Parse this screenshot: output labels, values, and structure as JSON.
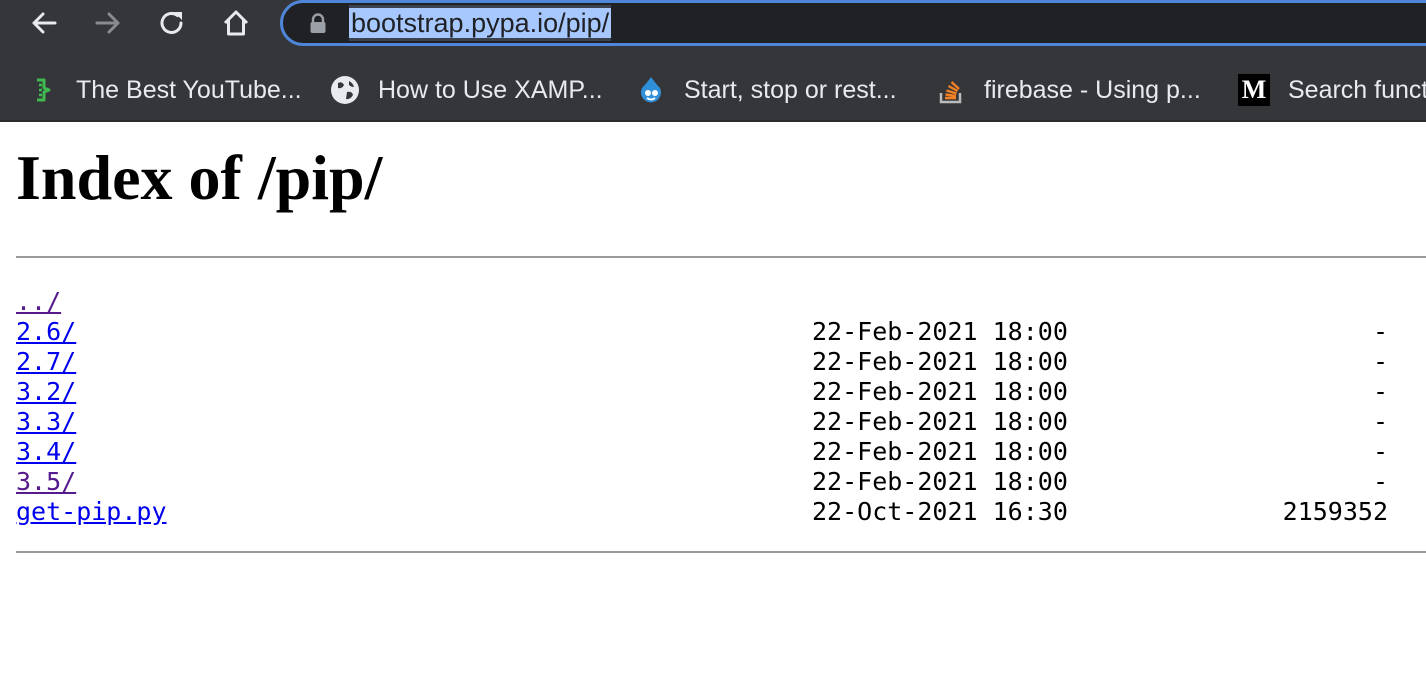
{
  "browser": {
    "url": "bootstrap.pypa.io/pip/",
    "bookmarks": [
      {
        "label": "The Best YouTube...",
        "icon": "green-bracket-icon"
      },
      {
        "label": "How to Use XAMP...",
        "icon": "globe-icon"
      },
      {
        "label": "Start, stop or rest...",
        "icon": "drupal-drop-icon"
      },
      {
        "label": "firebase - Using p...",
        "icon": "stack-overflow-icon"
      },
      {
        "label": "Search funct",
        "icon": "medium-m-icon"
      }
    ]
  },
  "page": {
    "title": "Index of /pip/",
    "entries": [
      {
        "name": "../",
        "date": "",
        "size": ""
      },
      {
        "name": "2.6/",
        "date": "22-Feb-2021 18:00",
        "size": "-"
      },
      {
        "name": "2.7/",
        "date": "22-Feb-2021 18:00",
        "size": "-"
      },
      {
        "name": "3.2/",
        "date": "22-Feb-2021 18:00",
        "size": "-"
      },
      {
        "name": "3.3/",
        "date": "22-Feb-2021 18:00",
        "size": "-"
      },
      {
        "name": "3.4/",
        "date": "22-Feb-2021 18:00",
        "size": "-"
      },
      {
        "name": "3.5/",
        "date": "22-Feb-2021 18:00",
        "size": "-"
      },
      {
        "name": "get-pip.py",
        "date": "22-Oct-2021 16:30",
        "size": "2159352"
      }
    ]
  },
  "colors": {
    "link": "#0000ee",
    "visited_link": "#551a8b",
    "toolbar_bg": "#35363a",
    "omnibox_border": "#4f86d9",
    "selection": "#a6c8ff"
  }
}
